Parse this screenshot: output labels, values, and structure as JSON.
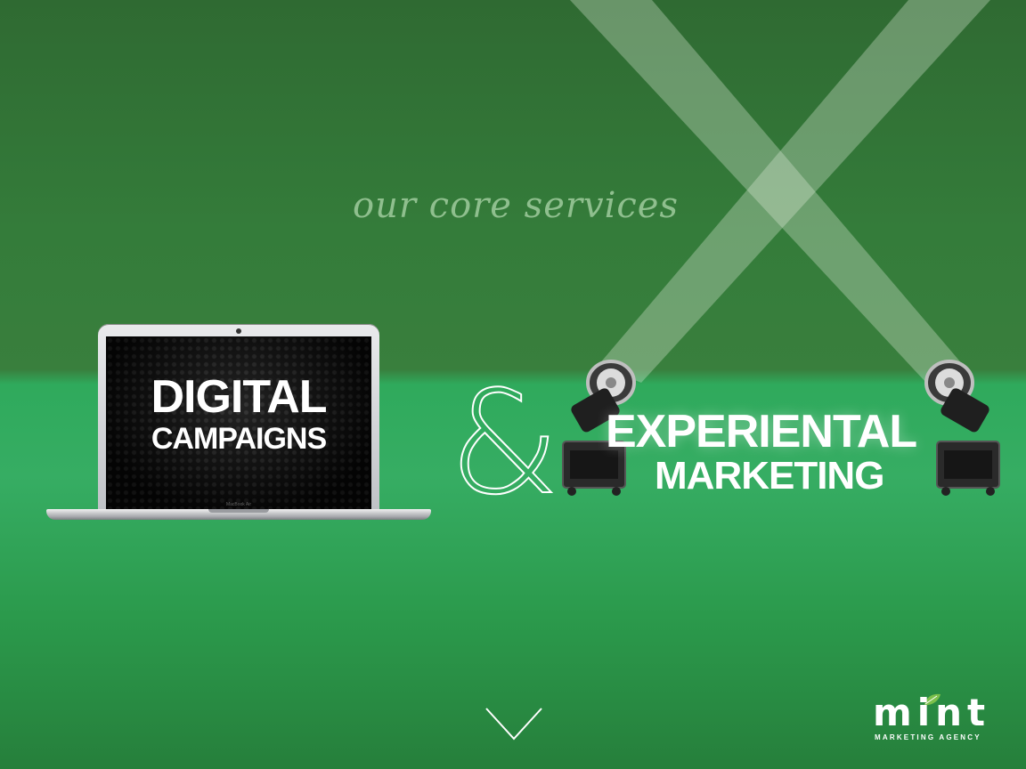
{
  "tagline": "our core services",
  "service_digital": {
    "line1": "DIGITAL",
    "line2": "CAMPAIGNS"
  },
  "laptop_label": "MacBook Air",
  "ampersand": "&",
  "service_experiential": {
    "line1": "EXPERIENTAL",
    "line2": "MARKETING"
  },
  "logo": {
    "word": "mint",
    "sub": "MARKETING AGENCY"
  },
  "icons": {
    "scroll_down": "chevron-down-icon",
    "leaf": "leaf-icon",
    "spotlight": "spotlight-icon"
  },
  "colors": {
    "background": "#2f8a45",
    "tagline": "#8fbf8e",
    "text": "#ffffff",
    "leaf": "#7cc04b"
  }
}
